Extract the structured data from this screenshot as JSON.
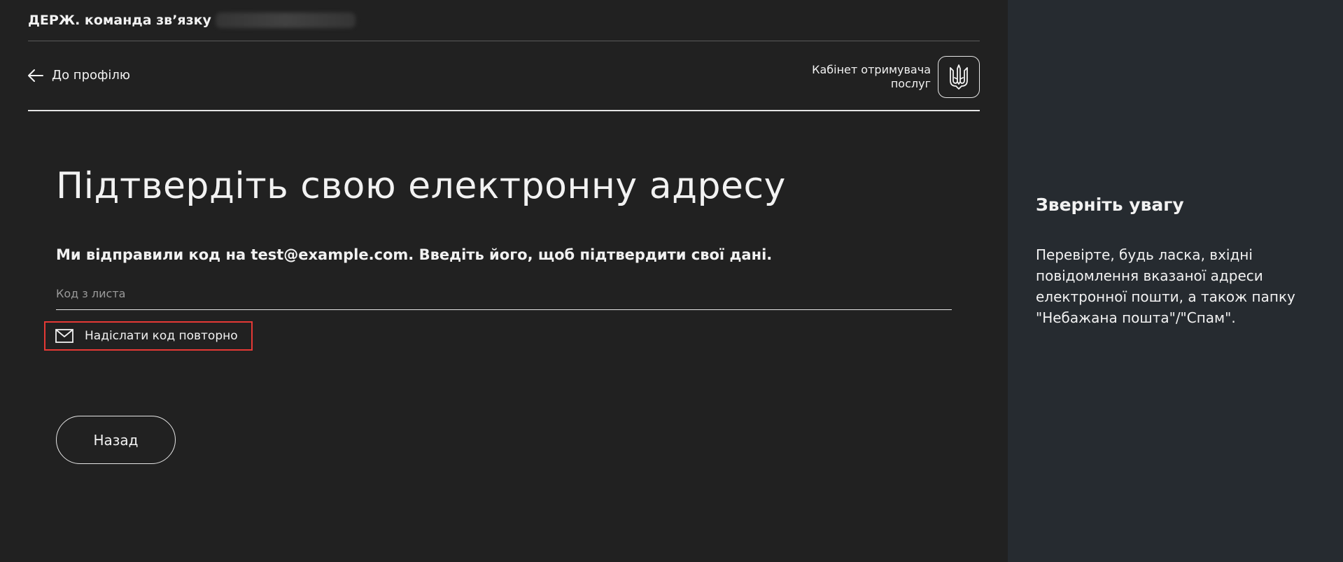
{
  "header": {
    "org_name": "ДЕРЖ. команда зв’язку",
    "back_link": "До профілю",
    "cabinet_label": "Кабінет отримувача послуг",
    "emblem_icon": "trident-emblem-icon"
  },
  "main": {
    "title": "Підтвердіть свою електронну адресу",
    "subtitle": "Ми відправили код на test@example.com. Введіть його, щоб підтвердити свої дані.",
    "code_field": {
      "placeholder": "Код з листа",
      "value": ""
    },
    "resend_button": {
      "label": "Надіслати код повторно",
      "icon": "mail-icon"
    },
    "back_button": "Назад"
  },
  "aside": {
    "title": "Зверніть увагу",
    "text": "Перевірте, будь ласка, вхідні повідомлення вказаної адреси електронної пошти, а також папку \"Небажана пошта\"/\"Спам\"."
  },
  "colors": {
    "main_bg": "#212121",
    "aside_bg": "#262b30",
    "text": "#f2f2f2",
    "highlight": "#e53935"
  }
}
